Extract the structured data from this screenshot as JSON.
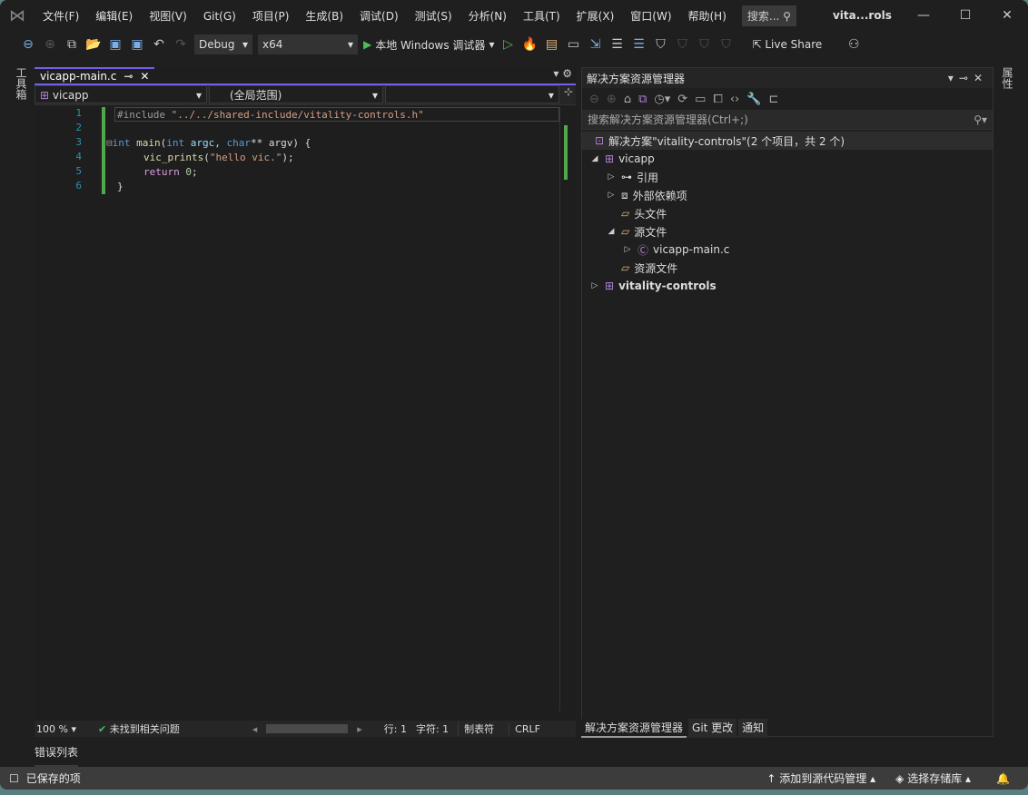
{
  "window": {
    "title": "vita...rols",
    "search": "搜索...",
    "minimize": "—",
    "maximize": "☐",
    "close": "✕"
  },
  "menu": [
    "文件(F)",
    "编辑(E)",
    "视图(V)",
    "Git(G)",
    "项目(P)",
    "生成(B)",
    "调试(D)",
    "测试(S)",
    "分析(N)",
    "工具(T)",
    "扩展(X)",
    "窗口(W)",
    "帮助(H)"
  ],
  "toolbar": {
    "config": "Debug",
    "platform": "x64",
    "run_label": "本地 Windows 调试器",
    "live_share": "Live Share"
  },
  "side": {
    "left": "工具箱",
    "right": "属性"
  },
  "editor": {
    "tab": "vicapp-main.c",
    "nav_project": "vicapp",
    "nav_scope": "(全局范围)",
    "nav_member": "",
    "lines": [
      "1",
      "2",
      "3",
      "4",
      "5",
      "6"
    ],
    "code": {
      "l1_pp": "#include ",
      "l1_str": "\"../../shared-include/vitality-controls.h\"",
      "l3_kw1": "int",
      "l3_fn": " main",
      "l3_p1": "(",
      "l3_kw2": "int",
      "l3_a1": " argc, ",
      "l3_kw3": "char",
      "l3_a2": "** argv) {",
      "l4_fn": "vic_prints",
      "l4_p": "(",
      "l4_str": "\"hello vic.\"",
      "l4_e": ");",
      "l5_kw": "return",
      "l5_num": " 0",
      "l5_e": ";",
      "l6": "}"
    },
    "status": {
      "zoom": "100 %",
      "issues": "未找到相关问题",
      "line": "行: 1",
      "char": "字符: 1",
      "tabs": "制表符",
      "eol": "CRLF"
    }
  },
  "solution_explorer": {
    "title": "解决方案资源管理器",
    "search": "搜索解决方案资源管理器(Ctrl+;)",
    "tree": [
      {
        "label": "解决方案\"vitality-controls\"(2 个项目，共 2 个)"
      },
      {
        "label": "vicapp"
      },
      {
        "label": "引用"
      },
      {
        "label": "外部依赖项"
      },
      {
        "label": "头文件"
      },
      {
        "label": "源文件"
      },
      {
        "label": "vicapp-main.c"
      },
      {
        "label": "资源文件"
      },
      {
        "label": "vitality-controls"
      }
    ],
    "tabs": [
      "解决方案资源管理器",
      "Git 更改",
      "通知"
    ]
  },
  "error_list": "错误列表",
  "statusbar": {
    "saved": "已保存的项",
    "source_control": "添加到源代码管理",
    "repo": "选择存储库"
  },
  "colors": {
    "accent": "#7160e8",
    "change_bar": "#4ea84e"
  }
}
